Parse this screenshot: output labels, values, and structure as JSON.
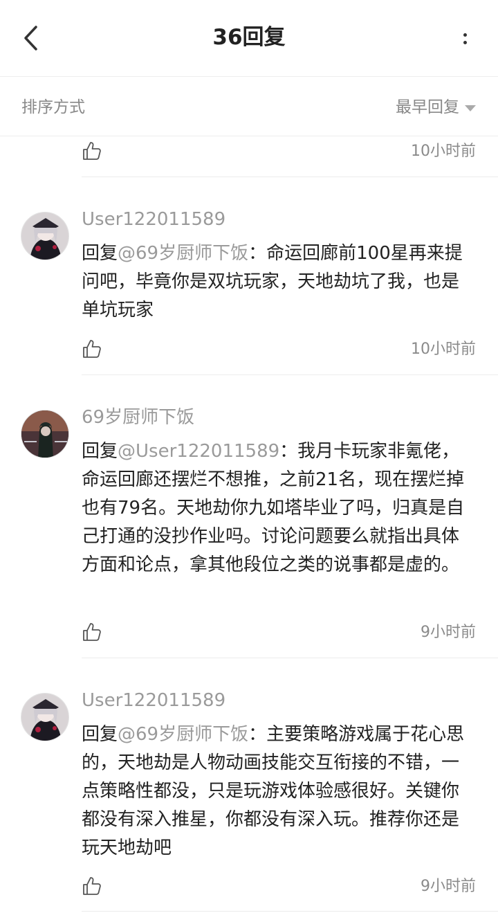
{
  "header": {
    "title": "36回复"
  },
  "sort": {
    "label": "排序方式",
    "selected": "最早回复"
  },
  "top_item": {
    "time": "10小时前"
  },
  "comments": [
    {
      "username": "User122011589",
      "reply_prefix": "回复",
      "mention": "@69岁厨师下饭",
      "separator": "：",
      "text": "命运回廊前100星再来提问吧，毕竟你是双坑玩家，天地劫坑了我，也是单坑玩家",
      "time": "10小时前"
    },
    {
      "username": "69岁厨师下饭",
      "reply_prefix": "回复",
      "mention": "@User122011589",
      "separator": "：",
      "text": "我月卡玩家非氪佬，命运回廊还摆烂不想推，之前21名，现在摆烂掉也有79名。天地劫你九如塔毕业了吗，归真是自己打通的没抄作业吗。讨论问题要么就指出具体方面和论点，拿其他段位之类的说事都是虚的。",
      "time": "9小时前"
    },
    {
      "username": "User122011589",
      "reply_prefix": "回复",
      "mention": "@69岁厨师下饭",
      "separator": "：",
      "text": "主要策略游戏属于花心思的，天地劫是人物动画技能交互衔接的不错，一点策略性都没，只是玩游戏体验感很好。关键你都没有深入推星，你都没有深入玩。推荐你还是玩天地劫吧",
      "time": "9小时前"
    }
  ],
  "colors": {
    "text_primary": "#222222",
    "text_secondary": "#9a9a9a",
    "divider": "#ececec"
  }
}
